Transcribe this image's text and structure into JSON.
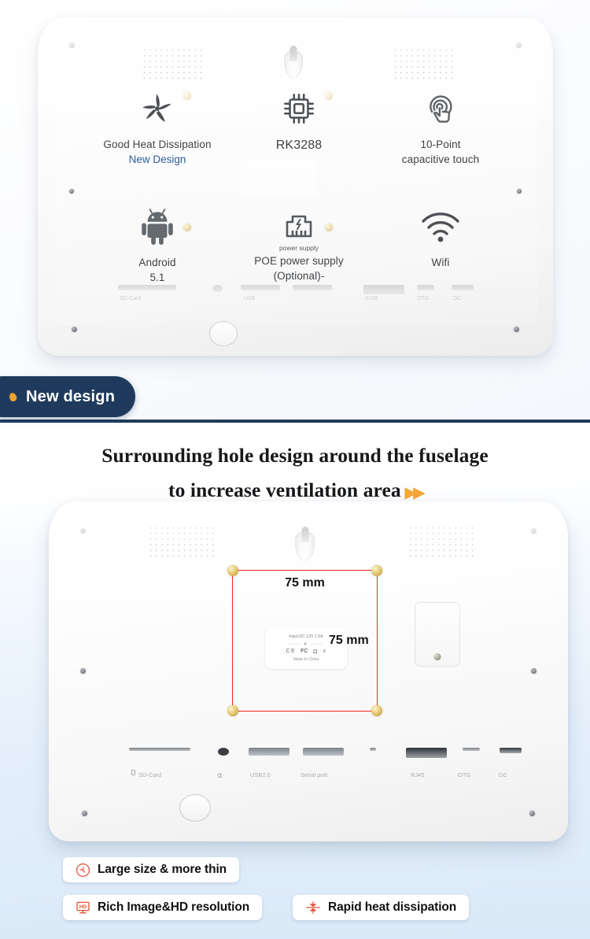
{
  "section_one": {
    "features": [
      {
        "icon": "fan-icon",
        "label": "Good Heat Dissipation",
        "sublabel": "New Design"
      },
      {
        "icon": "cpu-icon",
        "label": "RK3288",
        "sublabel": ""
      },
      {
        "icon": "touch-icon",
        "label": "10-Point",
        "sublabel": "capacitive touch"
      },
      {
        "icon": "android-icon",
        "label": "Android",
        "sublabel": "5.1"
      },
      {
        "icon": "poe-icon",
        "caption": "power supply",
        "label": "POE power supply",
        "sublabel": "(Optional)-"
      },
      {
        "icon": "wifi-icon",
        "label": "Wifi",
        "sublabel": ""
      }
    ],
    "ports": [
      {
        "name": "SD-Card"
      },
      {
        "name": ""
      },
      {
        "name": "USB"
      },
      {
        "name": ""
      },
      {
        "name": "RJ45"
      },
      {
        "name": "OTG"
      },
      {
        "name": "DC"
      }
    ]
  },
  "badge": {
    "label": "New design",
    "dot_color": "#f0a02e",
    "background": "#1f3a5c"
  },
  "section_two": {
    "headline_line_1": "Surrounding hole design around the fuselage",
    "headline_line_2": "to increase ventilation area",
    "headline_arrows": "▶▶",
    "vesa": {
      "width_label": "75 mm",
      "height_label": "75 mm",
      "line_color": "#ee2a22"
    },
    "product_label": {
      "line1": "Input:DC 12V 1.5A",
      "line2": "—○— ◉ —○—",
      "certs": "CE  FC",
      "line3": "Made In China"
    },
    "ports": [
      {
        "name": "SD-Card"
      },
      {
        "name": "⌂"
      },
      {
        "name": "USB2.0"
      },
      {
        "name": "Serial port"
      },
      {
        "name": "RJ45"
      },
      {
        "name": "OTG"
      },
      {
        "name": "DC"
      }
    ]
  },
  "pills": [
    {
      "icon": "fan-circle-icon",
      "label": "Large size & more thin",
      "color": "#e2553a"
    },
    {
      "icon": "hd-monitor-icon",
      "label": "Rich Image&HD resolution",
      "color": "#e2553a"
    },
    {
      "icon": "heat-dissipation-icon",
      "label": "Rapid heat dissipation",
      "color": "#e2553a"
    }
  ]
}
